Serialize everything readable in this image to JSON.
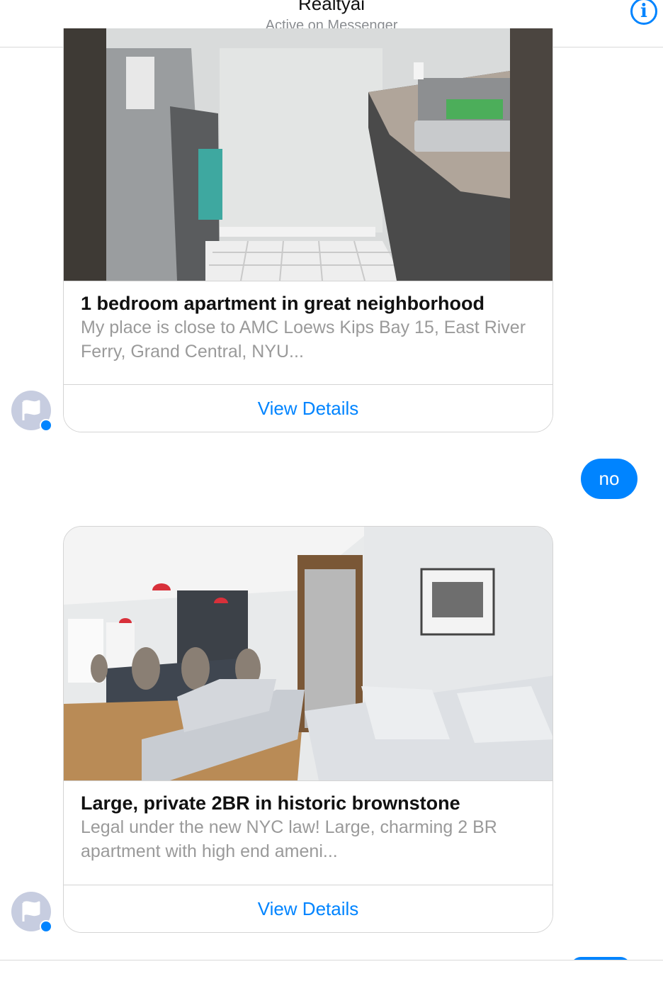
{
  "header": {
    "title": "Realtyai",
    "status": "Active on Messenger",
    "info_icon": "info-icon"
  },
  "messages": [
    {
      "type": "card",
      "title": "1 bedroom apartment in great neighborhood",
      "description": "My place is close to AMC Loews Kips Bay 15, East River Ferry, Grand Central, NYU...",
      "action_label": "View Details",
      "image": "kitchen-photo"
    },
    {
      "type": "text",
      "from": "user",
      "text": "no"
    },
    {
      "type": "card",
      "title": "Large, private 2BR in historic brownstone",
      "description": "Legal under the new NYC law! Large, charming 2 BR apartment with high end ameni...",
      "action_label": "View Details",
      "image": "living-room-photo"
    }
  ],
  "colors": {
    "accent": "#0084ff",
    "muted_text": "#9a9a9a",
    "border": "#d4d4d4"
  }
}
